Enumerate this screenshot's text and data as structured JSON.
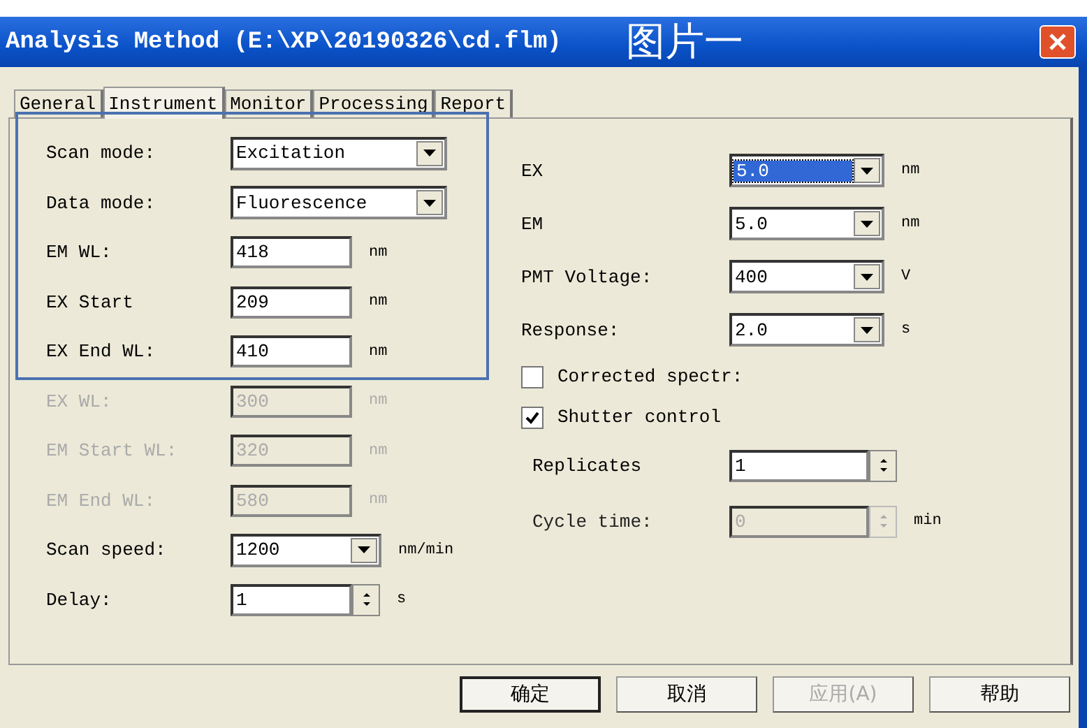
{
  "window": {
    "title": "Analysis Method (E:\\XP\\20190326\\cd.flm)",
    "annotation": "图片一"
  },
  "tabs": [
    {
      "label": "General",
      "selected": false
    },
    {
      "label": "Instrument",
      "selected": true
    },
    {
      "label": "Monitor",
      "selected": false
    },
    {
      "label": "Processing",
      "selected": false
    },
    {
      "label": "Report",
      "selected": false
    }
  ],
  "left_fields": [
    {
      "label": "Scan mode:",
      "kind": "dropdown",
      "value": "Excitation",
      "disabled": false
    },
    {
      "label": "Data mode:",
      "kind": "dropdown",
      "value": "Fluorescence",
      "disabled": false
    },
    {
      "label": "EM WL:",
      "kind": "text",
      "value": "418",
      "unit": "nm",
      "disabled": false
    },
    {
      "label": "EX Start",
      "kind": "text",
      "value": "209",
      "unit": "nm",
      "disabled": false
    },
    {
      "label": "EX End WL:",
      "kind": "text",
      "value": "410",
      "unit": "nm",
      "disabled": false
    },
    {
      "label": "EX WL:",
      "kind": "text",
      "value": "300",
      "unit": "nm",
      "disabled": true
    },
    {
      "label": "EM Start WL:",
      "kind": "text",
      "value": "320",
      "unit": "nm",
      "disabled": true
    },
    {
      "label": "EM End WL:",
      "kind": "text",
      "value": "580",
      "unit": "nm",
      "disabled": true
    },
    {
      "label": "Scan speed:",
      "kind": "shortdrop",
      "value": "1200",
      "unit": "nm/min",
      "disabled": false
    },
    {
      "label": "Delay:",
      "kind": "spin",
      "value": "1",
      "unit": "s",
      "disabled": false
    }
  ],
  "right_fields": [
    {
      "label": "EX",
      "kind": "dropdown",
      "value": "5.0",
      "unit": "nm",
      "focused": true
    },
    {
      "label": "EM",
      "kind": "dropdown",
      "value": "5.0",
      "unit": "nm",
      "focused": false
    },
    {
      "label": "PMT Voltage:",
      "kind": "dropdown",
      "value": "400",
      "unit": "V",
      "focused": false
    },
    {
      "label": "Response:",
      "kind": "dropdown",
      "value": "2.0",
      "unit": "s",
      "focused": false
    },
    {
      "label": "Corrected spectr:",
      "kind": "checkbox",
      "checked": false
    },
    {
      "label": "Shutter control",
      "kind": "checkbox",
      "checked": true
    },
    {
      "label": "Replicates",
      "kind": "spin",
      "value": "1",
      "disabled": false
    },
    {
      "label": "Cycle time:",
      "kind": "spin",
      "value": "0",
      "unit": "min",
      "disabled": true
    }
  ],
  "buttons": [
    {
      "label": "确定",
      "default": true,
      "disabled": false
    },
    {
      "label": "取消",
      "default": false,
      "disabled": false
    },
    {
      "label": "应用(A)",
      "default": false,
      "disabled": true
    },
    {
      "label": "帮助",
      "default": false,
      "disabled": false
    }
  ]
}
